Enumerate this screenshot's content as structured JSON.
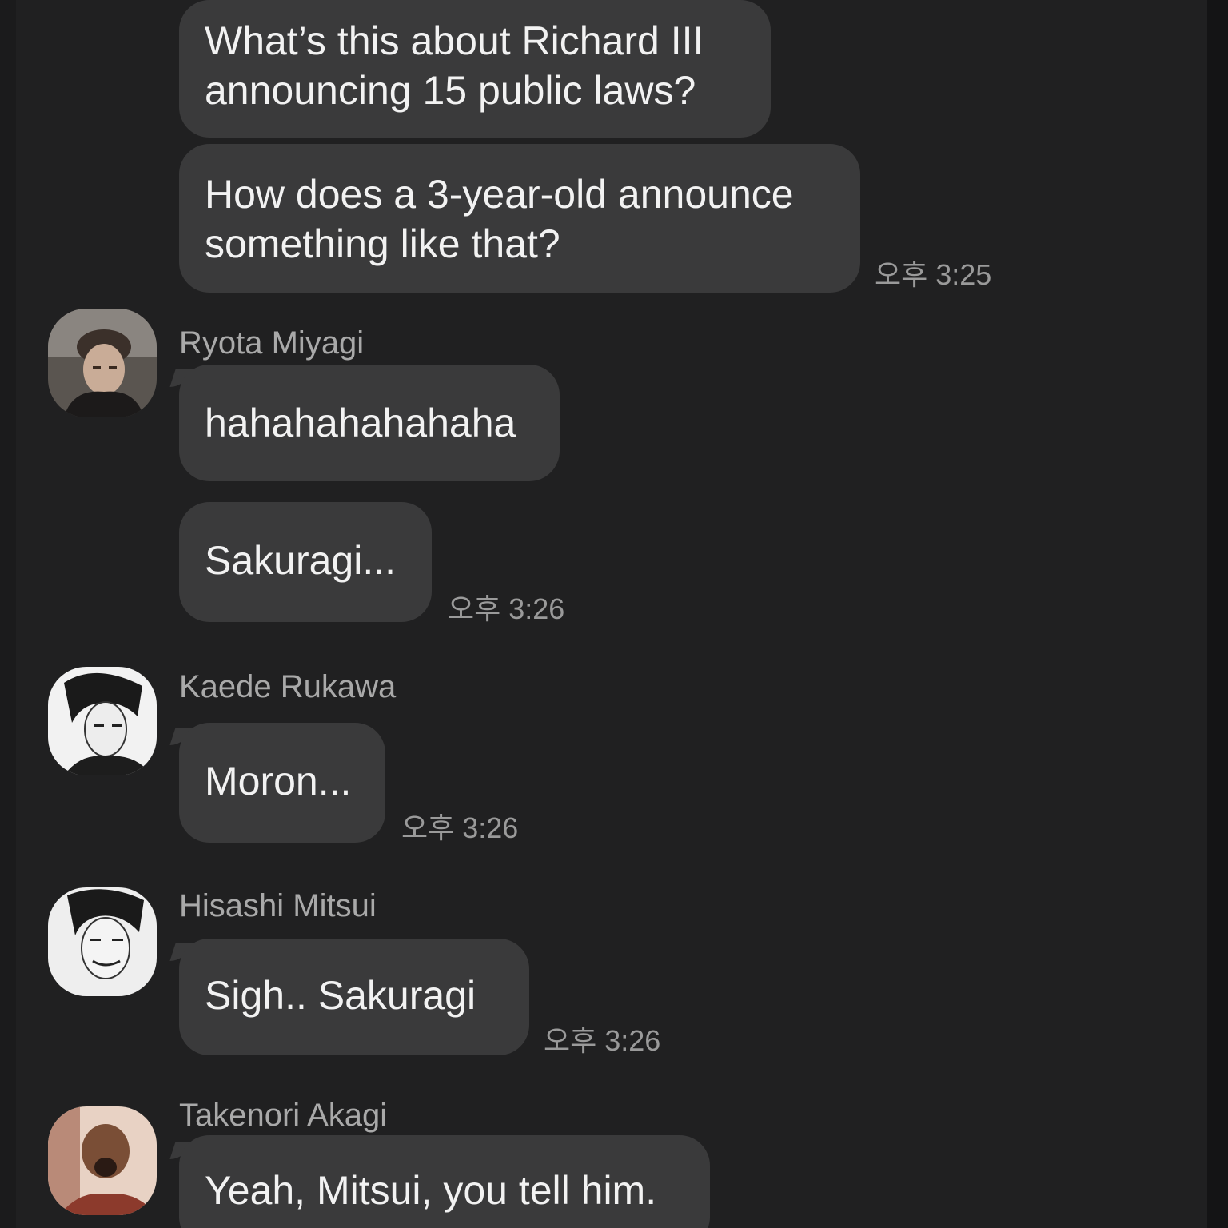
{
  "messages": [
    {
      "sender": "",
      "bubbles": [
        {
          "lines": [
            "What’s this about Richard III",
            "announcing 15 public laws?"
          ]
        },
        {
          "lines": [
            "How does a 3-year-old announce",
            "something like that?"
          ]
        }
      ],
      "time": "오후 3:25"
    },
    {
      "sender": "Ryota Miyagi",
      "avatar_icon": "avatar-ryota-miyagi-icon",
      "bubbles": [
        {
          "lines": [
            "hahahahahahaha"
          ]
        },
        {
          "lines": [
            "Sakuragi..."
          ]
        }
      ],
      "time": "오후 3:26"
    },
    {
      "sender": "Kaede Rukawa",
      "avatar_icon": "avatar-kaede-rukawa-icon",
      "bubbles": [
        {
          "lines": [
            "Moron..."
          ]
        }
      ],
      "time": "오후 3:26"
    },
    {
      "sender": "Hisashi Mitsui",
      "avatar_icon": "avatar-hisashi-mitsui-icon",
      "bubbles": [
        {
          "lines": [
            "Sigh.. Sakuragi"
          ]
        }
      ],
      "time": "오후 3:26"
    },
    {
      "sender": "Takenori Akagi",
      "avatar_icon": "avatar-takenori-akagi-icon",
      "bubbles": [
        {
          "lines": [
            "Yeah, Mitsui, you tell him."
          ]
        }
      ],
      "time": ""
    }
  ],
  "colors": {
    "background": "#202021",
    "bubble": "#3a3a3b",
    "text": "#f2f2f2",
    "sender_name": "#a9a9a9",
    "timestamp": "#9a9a9a"
  }
}
